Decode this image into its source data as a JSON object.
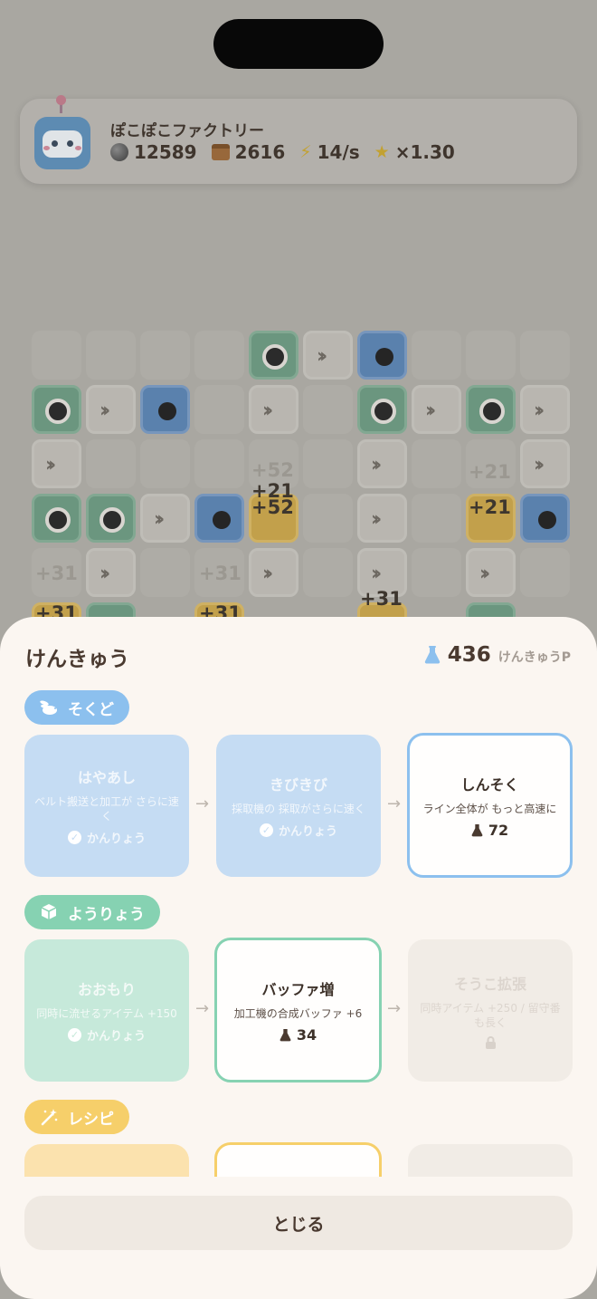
{
  "hud": {
    "title": "ぽこぽこファクトリー",
    "stone": "12589",
    "boxes": "2616",
    "rate": "14/s",
    "multiplier": "×1.30"
  },
  "floats": [
    "+52",
    "+21",
    "+52",
    "+21",
    "+21",
    "+31",
    "+31",
    "+31",
    "+31",
    "+31"
  ],
  "research": {
    "title": "けんきゅう",
    "points": "436",
    "points_unit": "けんきゅうP",
    "close_label": "とじる",
    "sections": [
      {
        "name": "そくど",
        "icon": "rabbit-icon",
        "cards": [
          {
            "name": "はやあし",
            "desc": "ベルト搬送と加工が さらに速く",
            "status": "かんりょう"
          },
          {
            "name": "きびきび",
            "desc": "採取機の 採取がさらに速く",
            "status": "かんりょう"
          },
          {
            "name": "しんそく",
            "desc": "ライン全体が もっと高速に",
            "cost": "72"
          }
        ]
      },
      {
        "name": "ようりょう",
        "icon": "box-icon",
        "cards": [
          {
            "name": "おおもり",
            "desc": "同時に流せるアイテム +150",
            "status": "かんりょう"
          },
          {
            "name": "バッファ増",
            "desc": "加工機の合成バッファ +6",
            "cost": "34"
          },
          {
            "name": "そうこ拡張",
            "desc": "同時アイテム +250 / 留守番も長く",
            "status": "locked"
          }
        ]
      },
      {
        "name": "レシピ",
        "icon": "wand-icon"
      }
    ]
  },
  "colors": {
    "speed": "#8cc0ee",
    "capacity": "#86d2b2",
    "recipe": "#f6cf6a",
    "sheet": "#fbf6f1"
  }
}
